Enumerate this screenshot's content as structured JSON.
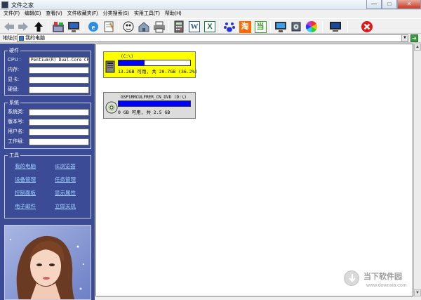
{
  "window": {
    "title": "文件之家",
    "controls": {
      "minimize": "—",
      "maximize": "□",
      "close": "✕"
    }
  },
  "menu": [
    "文件(F)",
    "编辑(E)",
    "查看(V)",
    "文件收藏夹(F)",
    "分类搜索(S)",
    "实用工具(T)",
    "帮助(H)"
  ],
  "toolbar": {
    "icons": [
      "back-icon",
      "forward-icon",
      "up-icon",
      "disk-cleanup-icon",
      "computer-icon",
      "ie-icon",
      "notepad-icon",
      "paint-icon",
      "home-icon",
      "printer-icon",
      "calculator-icon",
      "word-icon",
      "excel-icon",
      "baidu-icon",
      "taobao-icon",
      "dangdang-icon",
      "system-icon",
      "chip-icon",
      "color-icon",
      "display-icon",
      "exit-icon"
    ],
    "labels": {
      "word": "W",
      "excel": "X",
      "taobao": "淘",
      "dangdang": "当"
    }
  },
  "address": {
    "label": "地址(D)",
    "value": "我的电脑"
  },
  "sidebar": {
    "hardware": {
      "title": "硬件",
      "cpu_label": "CPU :",
      "cpu_value": "Pentium(R) Dual-Core  CPU",
      "memory_label": "内存:",
      "memory_value": "",
      "gpu_label": "显卡:",
      "gpu_value": "",
      "disk_label": "硬盘:",
      "disk_value": ""
    },
    "system": {
      "title": "系统",
      "os_label": "系统类:",
      "version_label": "版本号:",
      "user_label": "用户名:",
      "workgroup_label": "工作组:"
    },
    "tools": {
      "title": "工具",
      "links": [
        "我的电脑",
        "IE浏览器",
        "设备管理",
        "任务管理",
        "控制面板",
        "显示属性",
        "电子邮件",
        "立即关机"
      ]
    }
  },
  "drives": [
    {
      "name": "(C:\\)",
      "usage": "13.2GB 可用, 共 20.7GB (36.2%)",
      "used_fraction": 0.362
    },
    {
      "name": "GSP1RMCULFRER_CN_DVD (D:\\)",
      "usage": "0 GB 可用, 共 2.5 GB",
      "used_fraction": 1.0
    }
  ],
  "watermark": {
    "name": "当下软件园",
    "url": "www.downxia.com"
  },
  "colors": {
    "sidebar": "#3b4b96",
    "selected_drive": "#ffff00",
    "usage_bar": "#0000ff",
    "link": "#9fd0ff"
  }
}
